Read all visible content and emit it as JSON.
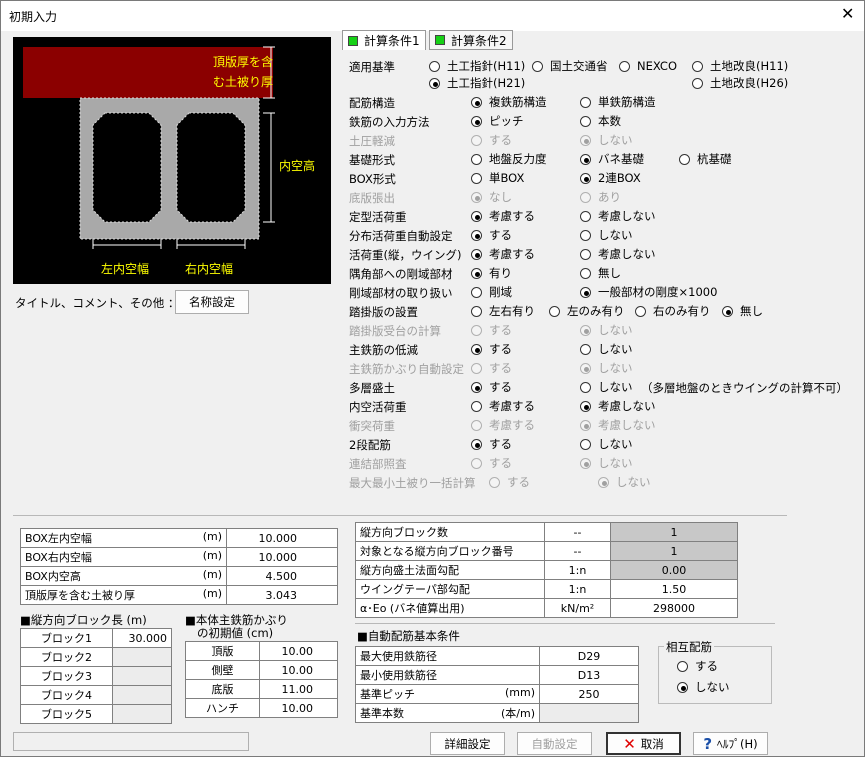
{
  "window": {
    "title": "初期入力",
    "close": "✕"
  },
  "diagram": {
    "top_label_1": "頂版厚を含",
    "top_label_2": "む土被り厚",
    "height_label": "内空高",
    "left_label": "左内空幅",
    "right_label": "右内空幅"
  },
  "title_row": {
    "label": "タイトル、コメント、その他 ：",
    "button": "名称設定"
  },
  "tabs": [
    "計算条件1",
    "計算条件2"
  ],
  "standard": {
    "label": "適用基準",
    "opt1": "土工指針(H11)",
    "opt2": "国土交通省",
    "opt3": "NEXCO",
    "opt4": "土地改良(H11)",
    "opt5": "土工指針(H21)",
    "opt6": "土地改良(H26)"
  },
  "rows": [
    {
      "label": "配筋構造",
      "a": "複鉄筋構造",
      "b": "単鉄筋構造"
    },
    {
      "label": "鉄筋の入力方法",
      "a": "ピッチ",
      "b": "本数"
    },
    {
      "label": "土圧軽減",
      "a": "する",
      "b": "しない"
    },
    {
      "label": "基礎形式",
      "a": "地盤反力度",
      "b": "バネ基礎",
      "c": "杭基礎"
    },
    {
      "label": "BOX形式",
      "a": "単BOX",
      "b": "2連BOX"
    },
    {
      "label": "底版張出",
      "a": "なし",
      "b": "あり"
    },
    {
      "label": "定型活荷重",
      "a": "考慮する",
      "b": "考慮しない"
    },
    {
      "label": "分布活荷重自動設定",
      "a": "する",
      "b": "しない"
    },
    {
      "label": "活荷重(縦，ウイング)",
      "a": "考慮する",
      "b": "考慮しない"
    },
    {
      "label": "隅角部への剛域部材",
      "a": "有り",
      "b": "無し"
    },
    {
      "label": "剛域部材の取り扱い",
      "a": "剛域",
      "b": "一般部材の剛度×1000"
    },
    {
      "label": "踏掛版の設置",
      "a": "左右有り",
      "b": "左のみ有り",
      "c": "右のみ有り",
      "d": "無し"
    },
    {
      "label": "踏掛版受台の計算",
      "a": "する",
      "b": "しない"
    },
    {
      "label": "主鉄筋の低減",
      "a": "する",
      "b": "しない"
    },
    {
      "label": "主鉄筋かぶり自動設定",
      "a": "する",
      "b": "しない"
    },
    {
      "label": "多層盛土",
      "a": "する",
      "b": "しない",
      "note": "（多層地盤のときウイングの計算不可）"
    },
    {
      "label": "内空活荷重",
      "a": "考慮する",
      "b": "考慮しない"
    },
    {
      "label": "衝突荷重",
      "a": "考慮する",
      "b": "考慮しない"
    },
    {
      "label": "2段配筋",
      "a": "する",
      "b": "しない"
    },
    {
      "label": "連結部照査",
      "a": "する",
      "b": "しない"
    },
    {
      "label": "最大最小土被り一括計算",
      "a": "する",
      "b": "しない"
    }
  ],
  "dims": [
    {
      "name": "BOX左内空幅",
      "unit": "(m)",
      "value": "10.000"
    },
    {
      "name": "BOX右内空幅",
      "unit": "(m)",
      "value": "10.000"
    },
    {
      "name": "BOX内空高",
      "unit": "(m)",
      "value": "4.500"
    },
    {
      "name": "頂版厚を含む土被り厚",
      "unit": "(m)",
      "value": "3.043"
    }
  ],
  "blocks": {
    "title": "■縦方向ブロック長 (m)",
    "rows": [
      {
        "name": "ブロック1",
        "value": "30.000"
      },
      {
        "name": "ブロック2",
        "value": ""
      },
      {
        "name": "ブロック3",
        "value": ""
      },
      {
        "name": "ブロック4",
        "value": ""
      },
      {
        "name": "ブロック5",
        "value": ""
      }
    ]
  },
  "cover": {
    "title_1": "■本体主鉄筋かぶり",
    "title_2": "の初期値 (cm)",
    "rows": [
      {
        "name": "頂版",
        "value": "10.00"
      },
      {
        "name": "側壁",
        "value": "10.00"
      },
      {
        "name": "底版",
        "value": "11.00"
      },
      {
        "name": "ハンチ",
        "value": "10.00"
      }
    ]
  },
  "longitudinal": [
    {
      "name": "縦方向ブロック数",
      "unit": "--",
      "value": "1"
    },
    {
      "name": "対象となる縦方向ブロック番号",
      "unit": "--",
      "value": "1"
    },
    {
      "name": "縦方向盛土法面勾配",
      "unit": "1:n",
      "value": "0.00"
    },
    {
      "name": "ウイングテーパ部勾配",
      "unit": "1:n",
      "value": "1.50"
    },
    {
      "name": "α･Eo (バネ値算出用)",
      "unit": "kN/m²",
      "value": "298000"
    }
  ],
  "auto_rebar": {
    "title": "■自動配筋基本条件",
    "rows": [
      {
        "name": "最大使用鉄筋径",
        "unit": "",
        "value": "D29"
      },
      {
        "name": "最小使用鉄筋径",
        "unit": "",
        "value": "D13"
      },
      {
        "name": "基準ピッチ",
        "unit": "(mm)",
        "value": "250"
      },
      {
        "name": "基準本数",
        "unit": "(本/m)",
        "value": ""
      }
    ]
  },
  "mutual": {
    "title": "相互配筋",
    "a": "する",
    "b": "しない"
  },
  "buttons": {
    "detail": "詳細設定",
    "auto": "自動設定",
    "cancel": "取消",
    "help": "ﾍﾙﾌﾟ(H)"
  },
  "colors": {
    "diagram_bg": "#000000",
    "soil": "#8b0000",
    "box": "#a9a9a9",
    "label": "#ffff00",
    "tab_indicator": "#17d117",
    "cancel_icon": "#e00000",
    "help_icon": "#1a4fa8"
  }
}
